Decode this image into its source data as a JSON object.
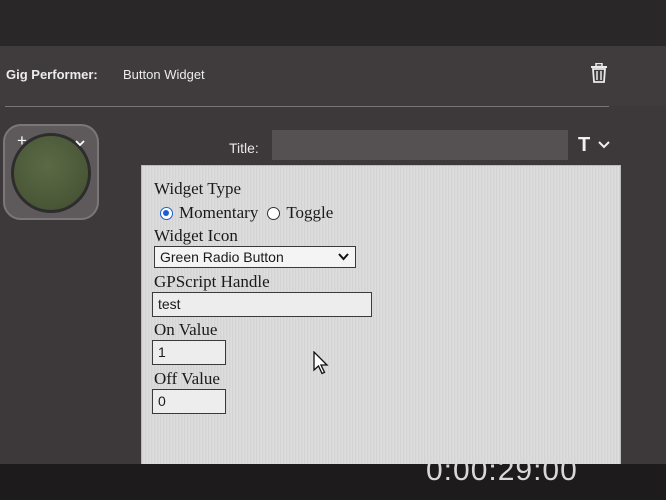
{
  "header": {
    "app_name": "Gig Performer:",
    "widget_title": "Button Widget"
  },
  "icons": {
    "trash": "trash-icon",
    "plus": "plus-icon",
    "chevron": "chevron-down-icon",
    "font": "text-format-icon",
    "cursor": "mouse-pointer-icon"
  },
  "button_widget": {
    "plus_glyph": "+",
    "led_color": "#4f5e3c"
  },
  "title_field": {
    "label": "Title:",
    "value": ""
  },
  "font_button": {
    "glyph": "T"
  },
  "properties": {
    "widget_type_label": "Widget Type",
    "type_options": [
      {
        "label": "Momentary",
        "checked": true
      },
      {
        "label": "Toggle",
        "checked": false
      }
    ],
    "widget_icon_label": "Widget Icon",
    "widget_icon_value": "Green Radio Button",
    "handle_label": "GPScript Handle",
    "handle_value": "test",
    "on_label": "On Value",
    "on_value": "1",
    "off_label": "Off Value",
    "off_value": "0"
  },
  "bottom": {
    "time_partial": "0:00:29:00"
  }
}
